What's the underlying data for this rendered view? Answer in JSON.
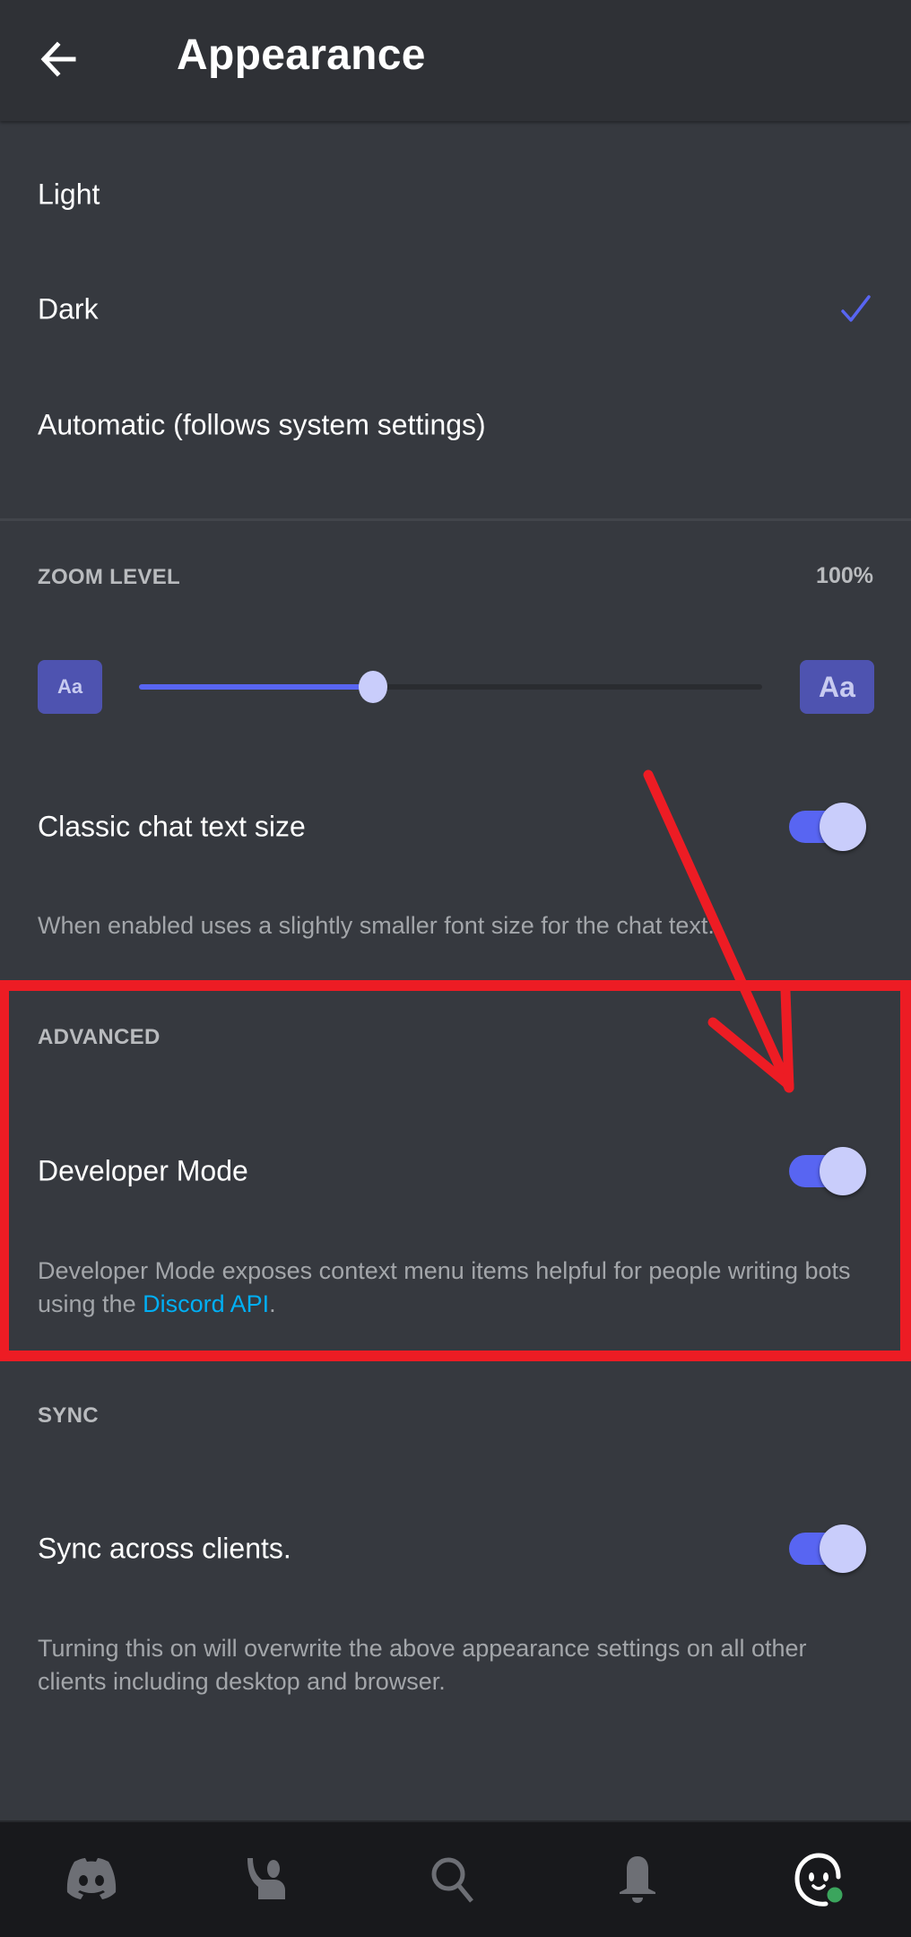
{
  "header": {
    "title": "Appearance",
    "back_icon": "arrow-left-icon"
  },
  "theme": {
    "options": [
      {
        "label": "Light",
        "selected": false
      },
      {
        "label": "Dark",
        "selected": true
      },
      {
        "label": "Automatic (follows system settings)",
        "selected": false
      }
    ],
    "selected_icon": "checkmark-icon"
  },
  "zoom": {
    "label": "ZOOM LEVEL",
    "value": "100%",
    "slider_fraction": 0.375,
    "small_button": "Aa",
    "large_button": "Aa"
  },
  "classic_chat": {
    "label": "Classic chat text size",
    "enabled": true,
    "description": "When enabled uses a slightly smaller font size for the chat text."
  },
  "advanced": {
    "section_label": "ADVANCED",
    "developer_mode": {
      "label": "Developer Mode",
      "enabled": true,
      "description_prefix": "Developer Mode exposes context menu items helpful for people writing bots using the ",
      "link_text": "Discord API",
      "description_suffix": "."
    }
  },
  "sync": {
    "section_label": "SYNC",
    "label": "Sync across clients.",
    "enabled": true,
    "description": "Turning this on will overwrite the above appearance settings on all other clients including desktop and browser."
  },
  "bottom_nav": {
    "items": [
      {
        "icon": "discord-home-icon",
        "active": false
      },
      {
        "icon": "friends-icon",
        "active": false
      },
      {
        "icon": "search-icon",
        "active": false
      },
      {
        "icon": "bell-icon",
        "active": false
      },
      {
        "icon": "profile-avatar-icon",
        "active": true,
        "status": "online"
      }
    ]
  },
  "colors": {
    "accent": "#5865f2",
    "background": "#36393f",
    "header": "#2f3136",
    "nav": "#18191c",
    "link": "#00aff4",
    "online": "#3ba55d",
    "annotation": "#ed1c24"
  }
}
